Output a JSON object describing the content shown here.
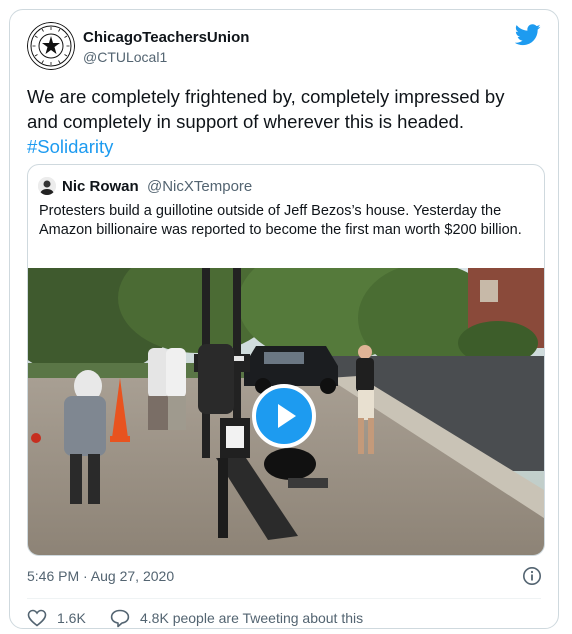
{
  "tweet": {
    "author_name": "ChicagoTeachersUnion",
    "author_handle": "@CTULocal1",
    "text": "We are completely frightened by, completely impressed by and completely in support of wherever this is headed.",
    "hashtag": "#Solidarity",
    "timestamp": "5:46 PM · Aug 27, 2020",
    "likes": "1.6K",
    "talk": "4.8K people are Tweeting about this"
  },
  "quote": {
    "author_name": "Nic Rowan",
    "author_handle": "@NicXTempore",
    "text": "Protesters build a guillotine outside of Jeff Bezos’s house. Yesterday the Amazon billionaire was reported to become the first man worth $200 billion."
  },
  "icons": {
    "brand": "twitter-bird-icon",
    "play": "play-icon",
    "info": "info-icon",
    "like": "heart-icon",
    "talk": "speech-bubble-icon"
  },
  "colors": {
    "accent": "#1d9bf0",
    "text": "#0f1419",
    "secondary": "#536471",
    "border": "#cfd9de"
  }
}
